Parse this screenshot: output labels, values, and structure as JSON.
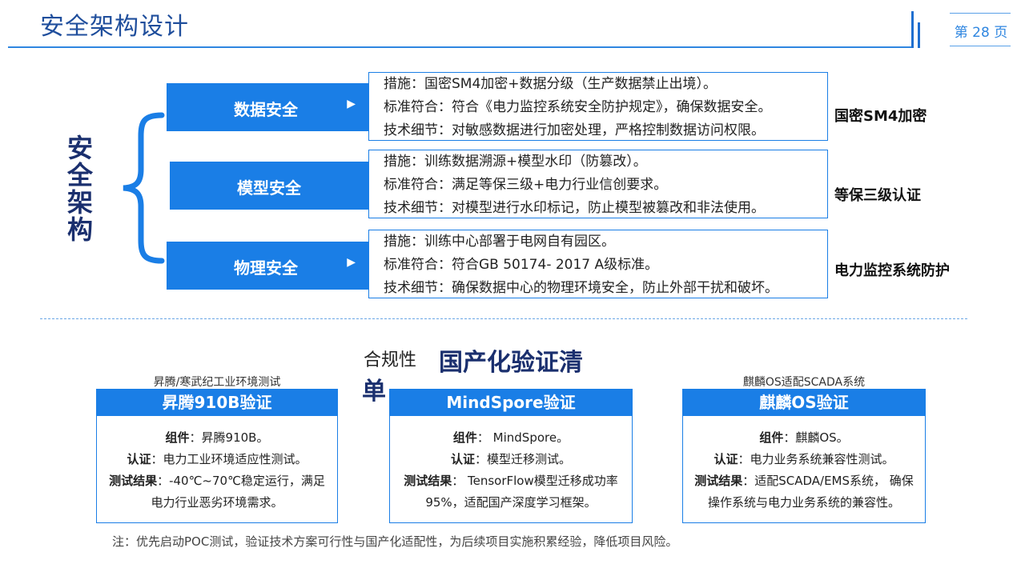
{
  "header": {
    "title": "安全架构设计",
    "page_label": "第 28 页"
  },
  "architecture": {
    "side_title": [
      "安",
      "全",
      "架",
      "构"
    ],
    "rows": [
      {
        "category": "数据安全",
        "measure": "措施：国密SM4加密+数据分级（生产数据禁止出境）。",
        "standard": "标准符合：符合《电力监控系统安全防护规定》，确保数据安全。",
        "detail": "技术细节：对敏感数据进行加密处理，严格控制数据访问权限。",
        "tag": "国密SM4加密"
      },
      {
        "category": "模型安全",
        "measure": "措施：训练数据溯源+模型水印（防篡改）。",
        "standard": "标准符合：满足等保三级+电力行业信创要求。",
        "detail": "技术细节：对模型进行水印标记，防止模型被篡改和非法使用。",
        "tag": "等保三级认证"
      },
      {
        "category": "物理安全",
        "measure": "措施：训练中心部署于电网自有园区。",
        "standard": "标准符合：符合GB 50174- 2017 A级标准。",
        "detail": "技术细节：确保数据中心的物理环境安全，防止外部干扰和破坏。",
        "tag": "电力监控系统防护"
      }
    ]
  },
  "compliance": {
    "heading_small": "合规性",
    "heading_big": "国产化验证清",
    "heading_tail": "单",
    "cards": [
      {
        "caption": "昇腾/寒武纪工业环境测试",
        "title": "昇腾910B验证",
        "component_label": "组件",
        "component": "：昇腾910B。",
        "cert_label": "认证",
        "cert": "：电力工业环境适应性测试。",
        "result_label": "测试结果",
        "result": "：‑40℃~70℃稳定运行，满足电力行业恶劣环境需求。"
      },
      {
        "caption": "",
        "title": "MindSpore验证",
        "component_label": "组件",
        "component": "： MindSpore。",
        "cert_label": "认证",
        "cert": "：模型迁移测试。",
        "result_label": "测试结果",
        "result": "： TensorFlow模型迁移成功率95%，适配国产深度学习框架。"
      },
      {
        "caption": "麒麟OS适配SCADA系统",
        "title": "麒麟OS验证",
        "component_label": "组件",
        "component": "：麒麟OS。",
        "cert_label": "认证",
        "cert": "：电力业务系统兼容性测试。",
        "result_label": "测试结果",
        "result": "：适配SCADA/EMS系统， 确保操作系统与电力业务系统的兼容性。"
      }
    ]
  },
  "footer": {
    "note": "注：优先启动POC测试，验证技术方案可行性与国产化适配性，为后续项目实施积累经验，降低项目风险。"
  },
  "colors": {
    "accent": "#1a7ee6",
    "title": "#1f4e9c",
    "dark_navy": "#1a2f6e"
  }
}
